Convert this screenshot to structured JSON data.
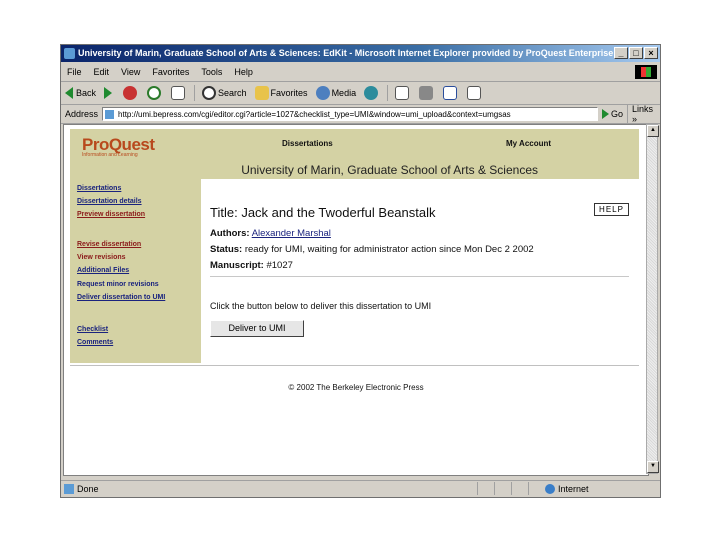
{
  "browser": {
    "title": "University of Marin, Graduate School of Arts & Sciences: EdKit - Microsoft Internet Explorer provided by ProQuest Enterprise S",
    "window_controls": [
      "_",
      "□",
      "×"
    ],
    "menu": [
      "File",
      "Edit",
      "View",
      "Favorites",
      "Tools",
      "Help"
    ],
    "toolbar": {
      "back": "Back",
      "search": "Search",
      "favorites": "Favorites",
      "media": "Media"
    },
    "address_label": "Address",
    "url": "http://umi.bepress.com/cgi/editor.cgi?article=1027&checklist_type=UMI&window=umi_upload&context=umgsas",
    "go": "Go",
    "links": "Links",
    "status_left": "Done",
    "status_zone": "Internet"
  },
  "page": {
    "logo": "ProQuest",
    "logo_tagline": "Information and Learning",
    "nav_dissertations": "Dissertations",
    "nav_account": "My Account",
    "university": "University of Marin, Graduate School of Arts & Sciences",
    "sidebar": {
      "dissertations": "Dissertations",
      "dissertation_details": "Dissertation details",
      "preview": "Preview dissertation",
      "revise": "Revise dissertation",
      "view_revisions": "View revisions",
      "additional_files": "Additional Files",
      "request_revisions": "Request minor revisions",
      "deliver": "Deliver dissertation to UMI",
      "checklist": "Checklist",
      "comments": "Comments"
    },
    "title_label": "Title:",
    "title": "Jack and the Twoderful Beanstalk",
    "help": "HELP",
    "authors_label": "Authors:",
    "authors": "Alexander   Marshal",
    "status_label": "Status:",
    "status": "ready for UMI, waiting for administrator action since Mon Dec 2 2002",
    "manuscript_label": "Manuscript:",
    "manuscript": "#1027",
    "deliver_prompt": "Click the button below to deliver this dissertation to UMI",
    "deliver_button": "Deliver to UMI",
    "footer": "© 2002 The Berkeley Electronic Press"
  },
  "colors": {
    "band": "#d4d2a4",
    "logo": "#b8491d",
    "link": "#1a237e",
    "link_active": "#8b1a1a"
  }
}
